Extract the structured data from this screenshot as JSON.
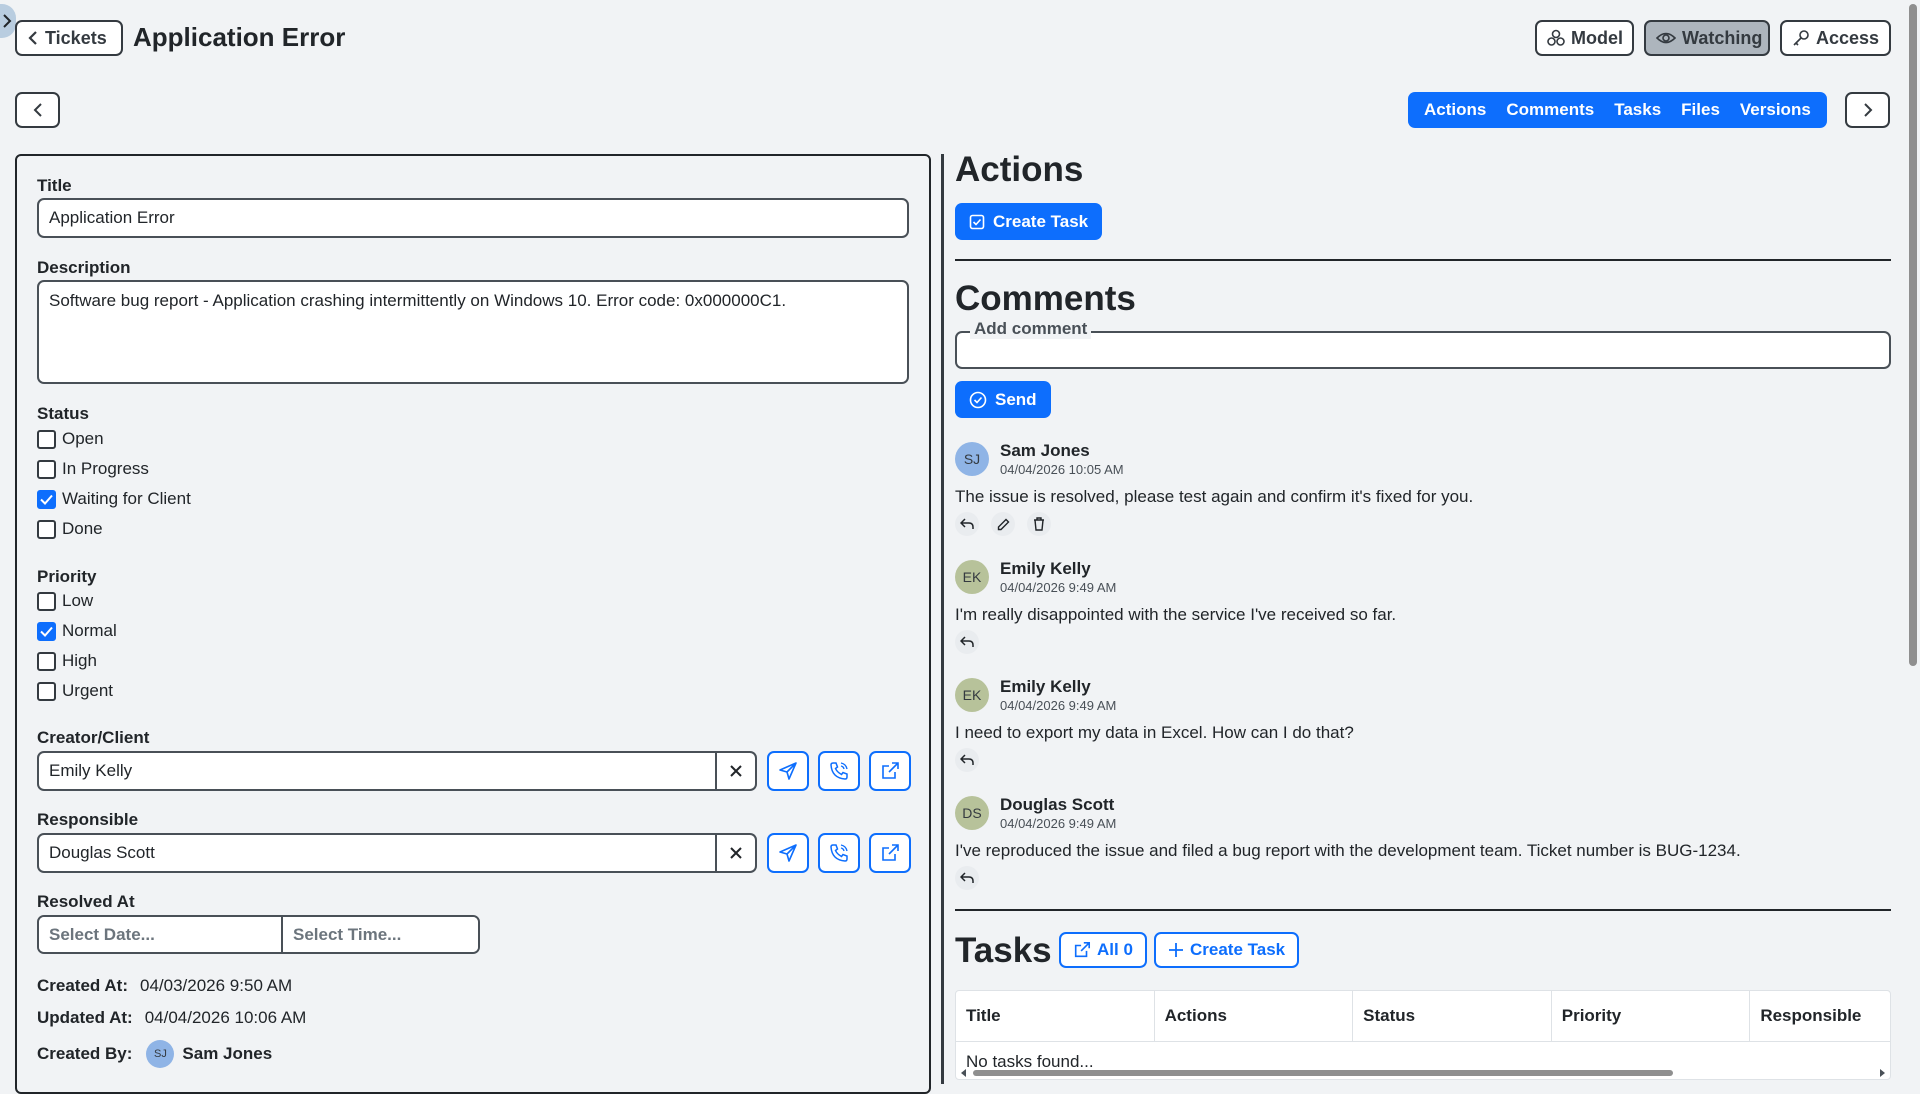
{
  "header": {
    "back_label": "Tickets",
    "title": "Application Error",
    "model_label": "Model",
    "watching_label": "Watching",
    "access_label": "Access"
  },
  "tabs": [
    "Actions",
    "Comments",
    "Tasks",
    "Files",
    "Versions"
  ],
  "form": {
    "title_label": "Title",
    "title_value": "Application Error",
    "description_label": "Description",
    "description_value": "Software bug report - Application crashing intermittently on Windows 10. Error code: 0x000000C1.",
    "status_label": "Status",
    "status_options": [
      {
        "label": "Open",
        "checked": false
      },
      {
        "label": "In Progress",
        "checked": false
      },
      {
        "label": "Waiting for Client",
        "checked": true
      },
      {
        "label": "Done",
        "checked": false
      }
    ],
    "priority_label": "Priority",
    "priority_options": [
      {
        "label": "Low",
        "checked": false
      },
      {
        "label": "Normal",
        "checked": true
      },
      {
        "label": "High",
        "checked": false
      },
      {
        "label": "Urgent",
        "checked": false
      }
    ],
    "creator_label": "Creator/Client",
    "creator_value": "Emily Kelly",
    "responsible_label": "Responsible",
    "responsible_value": "Douglas Scott",
    "resolved_label": "Resolved At",
    "date_placeholder": "Select Date...",
    "time_placeholder": "Select Time...",
    "created_at_label": "Created At:",
    "created_at_value": "04/03/2026 9:50 AM",
    "updated_at_label": "Updated At:",
    "updated_at_value": "04/04/2026 10:06 AM",
    "created_by_label": "Created By:",
    "created_by_initials": "SJ",
    "created_by_name": "Sam Jones"
  },
  "actions": {
    "title": "Actions",
    "create_task_label": "Create Task"
  },
  "comments": {
    "title": "Comments",
    "add_legend": "Add comment",
    "send_label": "Send",
    "items": [
      {
        "initials": "SJ",
        "name": "Sam Jones",
        "date": "04/04/2026 10:05 AM",
        "text": "The issue is resolved, please test again and confirm it's fixed for you.",
        "avatar_color": "#8fb4e6",
        "own": true
      },
      {
        "initials": "EK",
        "name": "Emily Kelly",
        "date": "04/04/2026 9:49 AM",
        "text": "I'm really disappointed with the service I've received so far.",
        "avatar_color": "#b7c29a",
        "own": false
      },
      {
        "initials": "EK",
        "name": "Emily Kelly",
        "date": "04/04/2026 9:49 AM",
        "text": "I need to export my data in Excel. How can I do that?",
        "avatar_color": "#b7c29a",
        "own": false
      },
      {
        "initials": "DS",
        "name": "Douglas Scott",
        "date": "04/04/2026 9:49 AM",
        "text": "I've reproduced the issue and filed a bug report with the development team. Ticket number is BUG-1234.",
        "avatar_color": "#b7c29a",
        "own": false
      }
    ]
  },
  "tasks": {
    "title": "Tasks",
    "all_label": "All 0",
    "create_label": "Create Task",
    "columns": [
      "Title",
      "Actions",
      "Status",
      "Priority",
      "Responsible"
    ],
    "empty_text": "No tasks found..."
  },
  "colors": {
    "primary": "#0d6efd",
    "background": "#f1f3f5"
  }
}
